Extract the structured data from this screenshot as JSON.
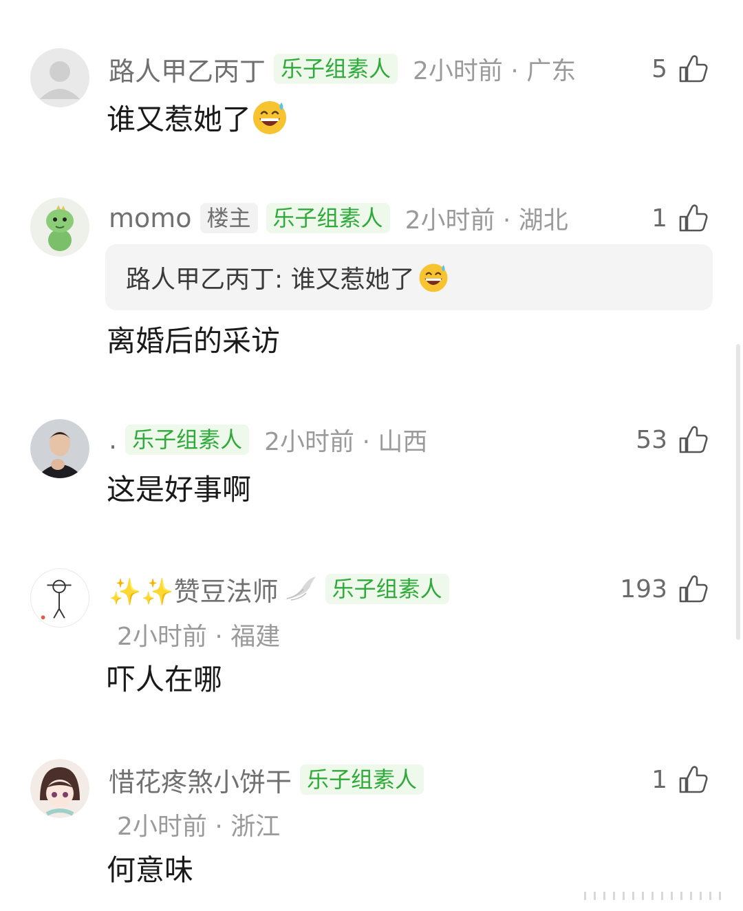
{
  "comments": [
    {
      "username": "路人甲乙丙丁",
      "badge": "乐子组素人",
      "meta": "2小时前 · 广东",
      "likes": "5",
      "text": "谁又惹她了"
    },
    {
      "username": "momo",
      "owner_badge": "楼主",
      "badge": "乐子组素人",
      "meta": "2小时前 · 湖北",
      "likes": "1",
      "quote": "路人甲乙丙丁: 谁又惹她了",
      "text": "离婚后的采访"
    },
    {
      "username": ".",
      "badge": "乐子组素人",
      "meta": "2小时前 · 山西",
      "likes": "53",
      "text": "这是好事啊"
    },
    {
      "username": "✨✨赞豆法师",
      "badge": "乐子组素人",
      "meta": "2小时前 · 福建",
      "likes": "193",
      "text": "吓人在哪"
    },
    {
      "username": "惜花疼煞小饼干",
      "badge": "乐子组素人",
      "meta": "2小时前 · 浙江",
      "likes": "1",
      "text": "何意味"
    }
  ],
  "icons": {
    "like": "thumbs-up-icon",
    "emoji": "grinning-sweat-emoji",
    "wing": "angel-wing-icon"
  },
  "colors": {
    "badge_text": "#2faa3a",
    "badge_bg": "#eef9ec",
    "username": "#707070",
    "meta": "#9a9a9a"
  }
}
